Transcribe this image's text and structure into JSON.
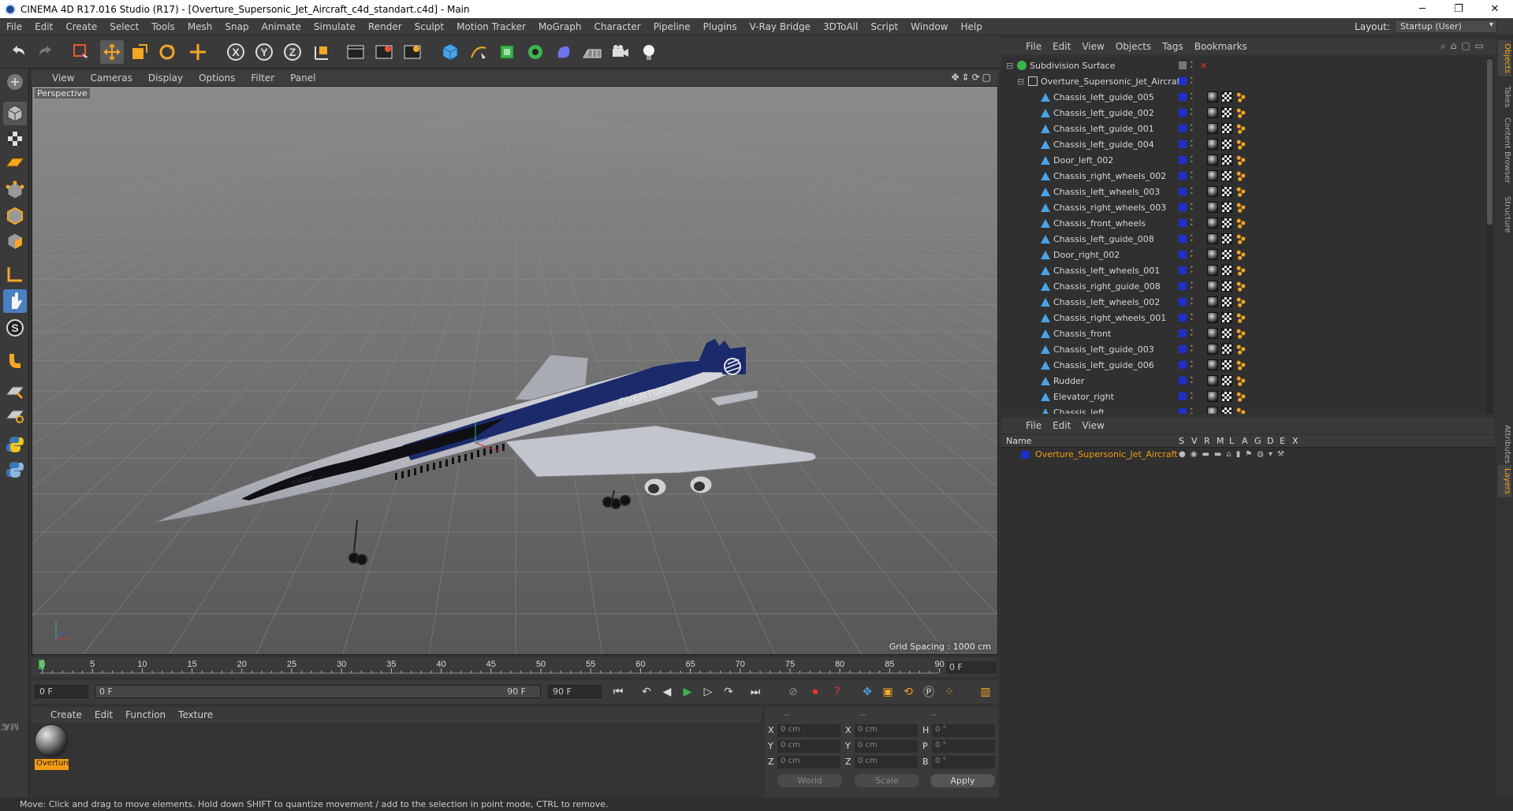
{
  "window": {
    "title": "CINEMA 4D R17.016 Studio (R17) - [Overture_Supersonic_Jet_Aircraft_c4d_standart.c4d] - Main",
    "minimize": "─",
    "maximize": "❐",
    "close": "✕"
  },
  "menu": [
    "File",
    "Edit",
    "Create",
    "Select",
    "Tools",
    "Mesh",
    "Snap",
    "Animate",
    "Simulate",
    "Render",
    "Sculpt",
    "Motion Tracker",
    "MoGraph",
    "Character",
    "Pipeline",
    "Plugins",
    "V-Ray Bridge",
    "3DToAll",
    "Script",
    "Window",
    "Help"
  ],
  "layout": {
    "label": "Layout:",
    "value": "Startup (User)"
  },
  "viewport": {
    "menu": [
      "View",
      "Cameras",
      "Display",
      "Options",
      "Filter",
      "Panel"
    ],
    "camera_label": "Perspective",
    "grid_spacing": "Grid Spacing : 1000 cm",
    "aircraft_text": "OVERTURE",
    "aircraft_reg": "N3800M"
  },
  "timeline": {
    "ticks": [
      "0",
      "5",
      "10",
      "15",
      "20",
      "25",
      "30",
      "35",
      "40",
      "45",
      "50",
      "55",
      "60",
      "65",
      "70",
      "75",
      "80",
      "85",
      "90"
    ],
    "current_frame": "0 F"
  },
  "transport": {
    "start_field": "0 F",
    "range_start": "0 F",
    "range_end": "90 F",
    "end_field": "90 F"
  },
  "material_manager": {
    "menu": [
      "Create",
      "Edit",
      "Function",
      "Texture"
    ],
    "material_name": "Overture"
  },
  "coordinates": {
    "headers": [
      "--",
      "--",
      "--"
    ],
    "rows": [
      {
        "a": "X",
        "av": "0 cm",
        "b": "X",
        "bv": "0 cm",
        "c": "H",
        "cv": "0 °"
      },
      {
        "a": "Y",
        "av": "0 cm",
        "b": "Y",
        "bv": "0 cm",
        "c": "P",
        "cv": "0 °"
      },
      {
        "a": "Z",
        "av": "0 cm",
        "b": "Z",
        "bv": "0 cm",
        "c": "B",
        "cv": "0 °"
      }
    ],
    "world": "World",
    "scale": "Scale",
    "apply": "Apply"
  },
  "status": "Move: Click and drag to move elements. Hold down SHIFT to quantize movement / add to the selection in point mode, CTRL to remove.",
  "object_manager": {
    "menu": [
      "File",
      "Edit",
      "View",
      "Objects",
      "Tags",
      "Bookmarks"
    ],
    "objects": [
      "Subdivision Surface",
      "Overture_Supersonic_Jet_Aircraft",
      "Chassis_left_guide_005",
      "Chassis_left_guide_002",
      "Chassis_left_guide_001",
      "Chassis_left_guide_004",
      "Door_left_002",
      "Chassis_right_wheels_002",
      "Chassis_left_wheels_003",
      "Chassis_right_wheels_003",
      "Chassis_front_wheels",
      "Chassis_left_guide_008",
      "Door_right_002",
      "Chassis_left_wheels_001",
      "Chassis_right_guide_008",
      "Chassis_left_wheels_002",
      "Chassis_right_wheels_001",
      "Chassis_front",
      "Chassis_left_guide_003",
      "Chassis_left_guide_006",
      "Rudder",
      "Elevator_right",
      "Chassis_left"
    ]
  },
  "right_tabs": [
    "Objects",
    "Takes",
    "Content Browser",
    "Structure",
    "Attributes",
    "Layers"
  ],
  "layer_manager": {
    "menu": [
      "File",
      "Edit",
      "View"
    ],
    "columns": [
      "Name",
      "S",
      "V",
      "R",
      "M",
      "L",
      "A",
      "G",
      "D",
      "E",
      "X"
    ],
    "layer_name": "Overture_Supersonic_Jet_Aircraft"
  },
  "colors": {
    "accent": "#f39c12",
    "layer_blue": "#1e2fd0",
    "viewport_bg": "#6c6c6c"
  }
}
